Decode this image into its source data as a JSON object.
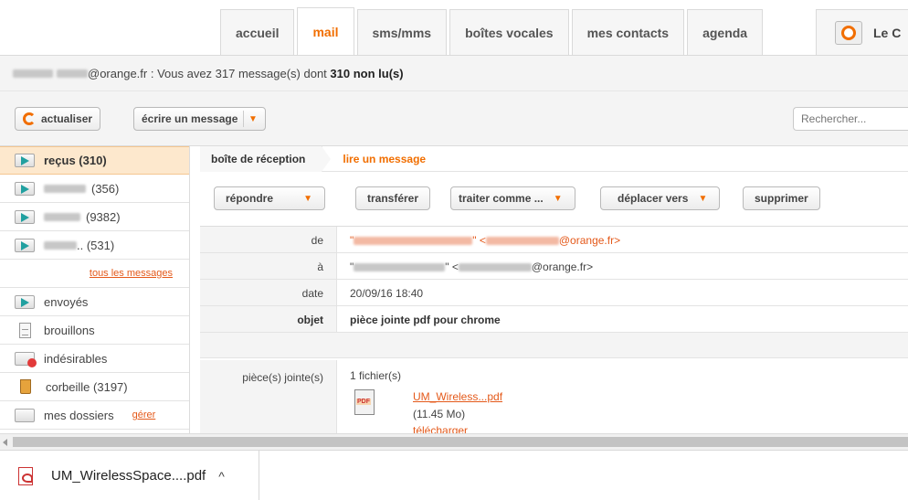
{
  "nav": {
    "tabs": [
      "accueil",
      "mail",
      "sms/mms",
      "boîtes vocales",
      "mes contacts",
      "agenda"
    ],
    "active_tab": "mail",
    "extra_tab": "Le C"
  },
  "status": {
    "email_suffix": "@orange.fr",
    "text": " : Vous avez 317 message(s) dont ",
    "unread": "310 non lu(s)"
  },
  "toolbar": {
    "refresh_label": "actualiser",
    "compose_label": "écrire un message",
    "search_placeholder": "Rechercher..."
  },
  "sidebar": {
    "items": [
      {
        "label": "reçus (310)"
      },
      {
        "label": "(356)"
      },
      {
        "label": "(9382)"
      },
      {
        "label": ".. (531)"
      }
    ],
    "all_messages_link": "tous les messages",
    "sent": "envoyés",
    "drafts": "brouillons",
    "spam": "indésirables",
    "trash": "corbeille (3197)",
    "folders": "mes dossiers",
    "manage_link": "gérer"
  },
  "breadcrumb": {
    "inbox": "boîte de réception",
    "current": "lire un message"
  },
  "actions": {
    "reply": "répondre",
    "forward": "transférer",
    "treat_as": "traiter comme ...",
    "move_to": "déplacer vers",
    "delete": "supprimer"
  },
  "message": {
    "from_label": "de",
    "from_value_suffix": "@orange.fr>",
    "to_label": "à",
    "to_value_suffix": "@orange.fr>",
    "date_label": "date",
    "date_value": "20/09/16 18:40",
    "subject_label": "objet",
    "subject_value": "pièce jointe pdf pour chrome",
    "attachments_label": "pièce(s) jointe(s)",
    "attachments_count": "1 fichier(s)",
    "file_name": "UM_Wireless...pdf",
    "file_size": "(11.45 Mo)",
    "download": "télécharger"
  },
  "download_shelf": {
    "file": "UM_WirelessSpace....pdf"
  },
  "colors": {
    "accent": "#f16e00",
    "link": "#e4591a",
    "active_folder_bg": "#fde8cd"
  }
}
